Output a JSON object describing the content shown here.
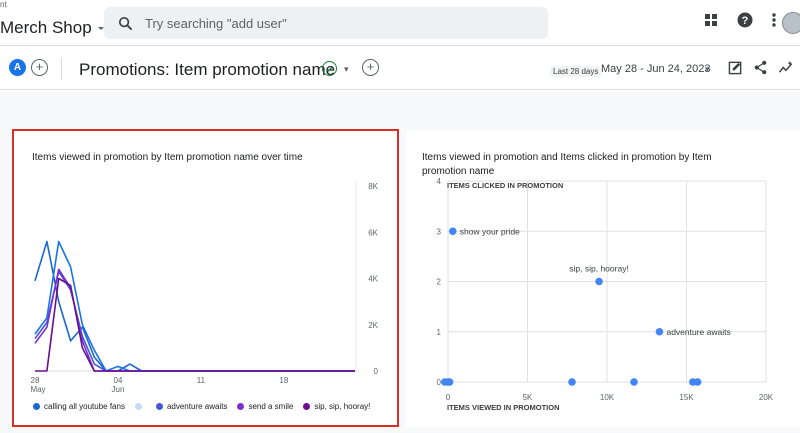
{
  "header": {
    "account_fragment": "nt",
    "property_name": "Merch Shop",
    "search_placeholder": "Try searching \"add user\""
  },
  "subheader": {
    "comparison_chip": "A",
    "title": "Promotions: Item promotion name",
    "date_chip": "Last 28 days",
    "date_range": "May 28 - Jun 24, 2023"
  },
  "colors": {
    "accent": "#1a73e8",
    "highlight_border": "#d93025",
    "success": "#188038"
  },
  "line_card": {
    "title": "Items viewed in promotion by Item promotion name over time",
    "legend": [
      {
        "name": "calling all youtube fans",
        "color": "#1967d2"
      },
      {
        "name": "",
        "color": "#c6dafc"
      },
      {
        "name": "adventure awaits",
        "color": "#4658d6"
      },
      {
        "name": "send a smile",
        "color": "#7b2fd0"
      },
      {
        "name": "sip, sip, hooray!",
        "color": "#6a0f8e"
      }
    ]
  },
  "scatter_card": {
    "title_line1": "Items viewed in promotion and Items clicked in promotion by Item",
    "title_line2": "promotion name"
  },
  "chart_data": [
    {
      "type": "line",
      "title": "Items viewed in promotion by Item promotion name over time",
      "x_tick_labels": [
        "28",
        "May",
        "04",
        "Jun",
        "11",
        "18"
      ],
      "y_tick_labels": [
        "8K",
        "6K",
        "4K",
        "2K",
        "0"
      ],
      "ylim": [
        0,
        8000
      ],
      "x_range": [
        "2023-05-28",
        "2023-06-24"
      ],
      "legend_position": "bottom",
      "series": [
        {
          "name": "calling all youtube fans",
          "color": "#1967d2",
          "values": [
            [
              "2023-05-28",
              3900
            ],
            [
              "2023-05-29",
              5600
            ],
            [
              "2023-05-30",
              3000
            ],
            [
              "2023-05-31",
              1300
            ],
            [
              "2023-06-01",
              1900
            ],
            [
              "2023-06-02",
              600
            ],
            [
              "2023-06-03",
              0
            ],
            [
              "2023-06-04",
              0
            ],
            [
              "2023-06-05",
              300
            ],
            [
              "2023-06-06",
              0
            ],
            [
              "2023-06-24",
              0
            ]
          ]
        },
        {
          "name": "",
          "color": "#1a73e8",
          "values": [
            [
              "2023-05-28",
              1600
            ],
            [
              "2023-05-29",
              2300
            ],
            [
              "2023-05-30",
              5600
            ],
            [
              "2023-05-31",
              4500
            ],
            [
              "2023-06-01",
              2000
            ],
            [
              "2023-06-02",
              900
            ],
            [
              "2023-06-03",
              0
            ],
            [
              "2023-06-04",
              200
            ],
            [
              "2023-06-05",
              0
            ],
            [
              "2023-06-24",
              0
            ]
          ]
        },
        {
          "name": "adventure awaits",
          "color": "#4658d6",
          "values": [
            [
              "2023-05-28",
              1400
            ],
            [
              "2023-05-29",
              2100
            ],
            [
              "2023-05-30",
              4300
            ],
            [
              "2023-05-31",
              3500
            ],
            [
              "2023-06-01",
              1500
            ],
            [
              "2023-06-02",
              300
            ],
            [
              "2023-06-03",
              0
            ],
            [
              "2023-06-24",
              0
            ]
          ]
        },
        {
          "name": "send a smile",
          "color": "#7b2fd0",
          "values": [
            [
              "2023-05-28",
              1200
            ],
            [
              "2023-05-29",
              1900
            ],
            [
              "2023-05-30",
              4400
            ],
            [
              "2023-05-31",
              3600
            ],
            [
              "2023-06-01",
              1300
            ],
            [
              "2023-06-02",
              0
            ],
            [
              "2023-06-24",
              0
            ]
          ]
        },
        {
          "name": "sip, sip, hooray!",
          "color": "#6a0f8e",
          "values": [
            [
              "2023-05-28",
              0
            ],
            [
              "2023-05-29",
              0
            ],
            [
              "2023-05-30",
              4000
            ],
            [
              "2023-05-31",
              3700
            ],
            [
              "2023-06-01",
              1000
            ],
            [
              "2023-06-02",
              0
            ],
            [
              "2023-06-24",
              0
            ]
          ]
        }
      ]
    },
    {
      "type": "scatter",
      "title": "Items viewed in promotion and Items clicked in promotion by Item promotion name",
      "xlabel": "ITEMS VIEWED IN PROMOTION",
      "ylabel": "ITEMS CLICKED IN PROMOTION",
      "xlim": [
        0,
        20000
      ],
      "ylim": [
        0,
        4
      ],
      "x_tick_labels": [
        "0",
        "5K",
        "10K",
        "15K",
        "20K"
      ],
      "y_tick_labels": [
        "0",
        "1",
        "2",
        "3",
        "4"
      ],
      "grid": true,
      "points": [
        {
          "x": 300,
          "y": 3,
          "label": "show your pride"
        },
        {
          "x": 9500,
          "y": 2,
          "label": "sip, sip, hooray!"
        },
        {
          "x": 13300,
          "y": 1,
          "label": "adventure awaits"
        },
        {
          "x": -200,
          "y": 0,
          "label": ""
        },
        {
          "x": 0,
          "y": 0,
          "label": ""
        },
        {
          "x": 100,
          "y": 0,
          "label": ""
        },
        {
          "x": 7800,
          "y": 0,
          "label": ""
        },
        {
          "x": 11700,
          "y": 0,
          "label": ""
        },
        {
          "x": 15400,
          "y": 0,
          "label": ""
        },
        {
          "x": 15700,
          "y": 0,
          "label": ""
        }
      ]
    }
  ]
}
